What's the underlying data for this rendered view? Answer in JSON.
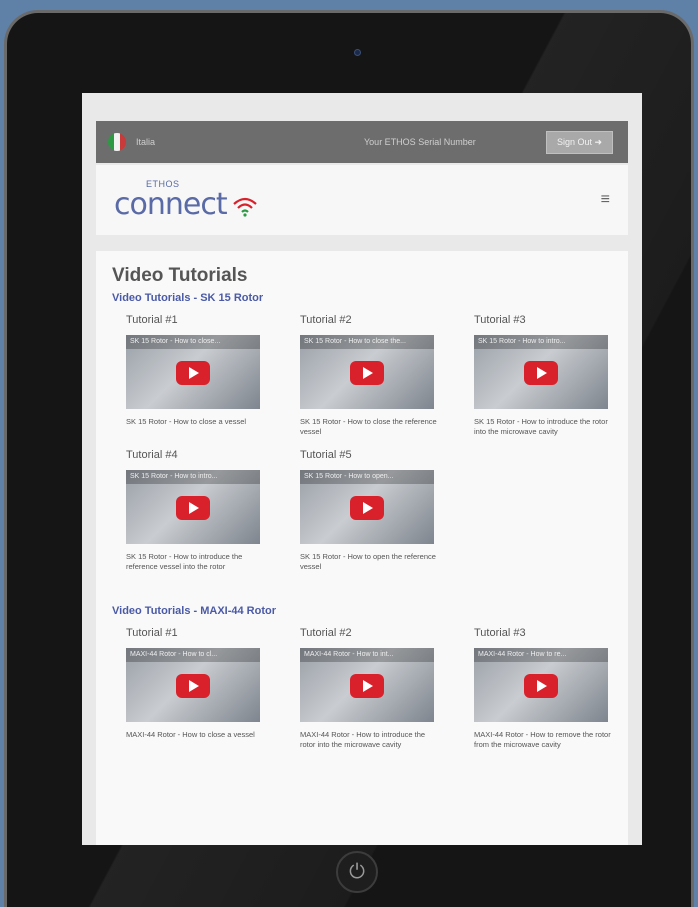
{
  "topbar": {
    "language": "Italia",
    "serial_label": "Your ETHOS Serial Number",
    "signout_label": "Sign Out ➜",
    "flag_colors": [
      "#2d9a43",
      "#f2f2f2",
      "#c93a3a"
    ]
  },
  "header": {
    "logo_small": "ETHOS",
    "logo_big": "connect",
    "menu_icon": "≡"
  },
  "page": {
    "title": "Video Tutorials"
  },
  "sections": [
    {
      "title": "Video Tutorials - SK 15 Rotor",
      "tutorials": [
        {
          "title": "Tutorial #1",
          "video_title": "SK 15 Rotor - How to close...",
          "desc": "SK 15 Rotor - How to close a vessel"
        },
        {
          "title": "Tutorial #2",
          "video_title": "SK 15 Rotor - How to close the...",
          "desc": "SK 15 Rotor - How to close the reference vessel"
        },
        {
          "title": "Tutorial #3",
          "video_title": "SK 15 Rotor - How to intro...",
          "desc": "SK 15 Rotor - How to introduce the rotor into the microwave cavity"
        },
        {
          "title": "Tutorial #4",
          "video_title": "SK 15 Rotor - How to intro...",
          "desc": "SK 15 Rotor - How to introduce the reference vessel into the rotor"
        },
        {
          "title": "Tutorial #5",
          "video_title": "SK 15 Rotor - How to open...",
          "desc": "SK 15 Rotor - How to open the reference vessel"
        }
      ]
    },
    {
      "title": "Video Tutorials - MAXI-44 Rotor",
      "tutorials": [
        {
          "title": "Tutorial #1",
          "video_title": "MAXI-44 Rotor - How to cl...",
          "desc": "MAXI-44 Rotor - How to close a vessel"
        },
        {
          "title": "Tutorial #2",
          "video_title": "MAXI-44 Rotor - How to int...",
          "desc": "MAXI-44 Rotor - How to introduce the rotor into the microwave cavity"
        },
        {
          "title": "Tutorial #3",
          "video_title": "MAXI-44 Rotor - How to re...",
          "desc": "MAXI-44 Rotor - How to remove the rotor from the microwave cavity"
        }
      ]
    }
  ],
  "colors": {
    "accent": "#4a5aa6",
    "play_button": "#d9212b",
    "background": "#5f81a8"
  }
}
